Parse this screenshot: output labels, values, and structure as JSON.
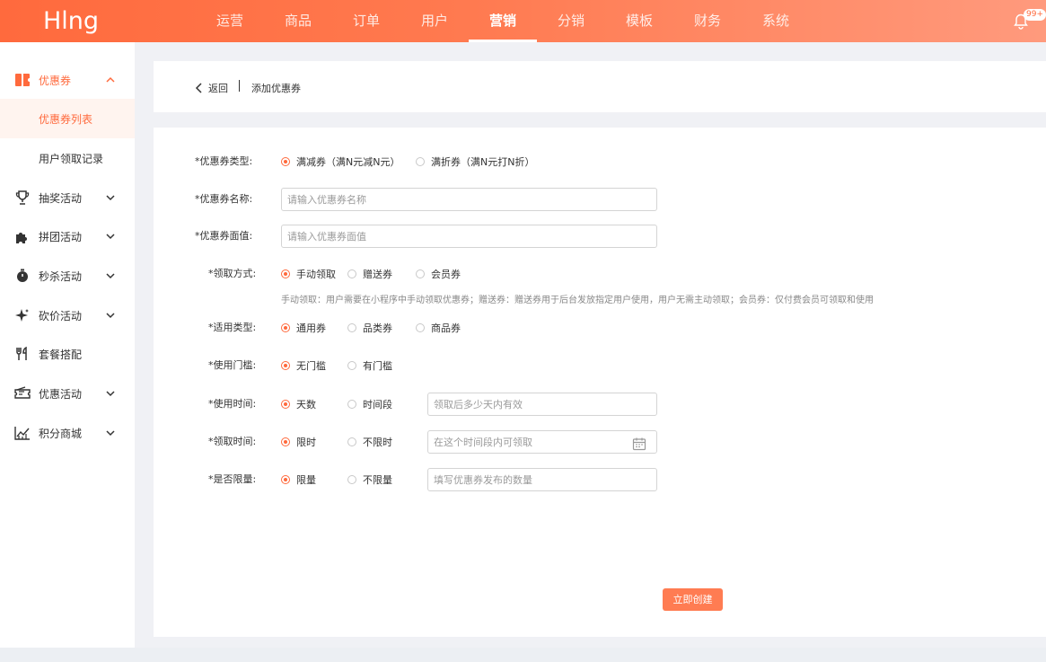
{
  "app": {
    "logo": "Hlng",
    "notification_count": "99+"
  },
  "nav": [
    {
      "label": "运营",
      "active": false
    },
    {
      "label": "商品",
      "active": false
    },
    {
      "label": "订单",
      "active": false
    },
    {
      "label": "用户",
      "active": false
    },
    {
      "label": "营销",
      "active": true
    },
    {
      "label": "分销",
      "active": false
    },
    {
      "label": "模板",
      "active": false
    },
    {
      "label": "财务",
      "active": false
    },
    {
      "label": "系统",
      "active": false
    }
  ],
  "sidebar": {
    "items": [
      {
        "label": "优惠券",
        "icon": "coupon-icon"
      },
      {
        "label": "抽奖活动",
        "icon": "trophy-icon"
      },
      {
        "label": "拼团活动",
        "icon": "puzzle-icon"
      },
      {
        "label": "秒杀活动",
        "icon": "stopwatch-icon"
      },
      {
        "label": "砍价活动",
        "icon": "sparkle-icon"
      },
      {
        "label": "套餐搭配",
        "icon": "utensils-icon"
      },
      {
        "label": "优惠活动",
        "icon": "ticket-icon"
      },
      {
        "label": "积分商城",
        "icon": "chart-icon"
      }
    ],
    "subitems": [
      {
        "label": "优惠券列表",
        "active": true
      },
      {
        "label": "用户领取记录",
        "active": false
      }
    ]
  },
  "breadcrumb": {
    "back": "返回",
    "current": "添加优惠券"
  },
  "form": {
    "type": {
      "label": "*优惠券类型:",
      "options": [
        "满减券（满N元减N元）",
        "满折券（满N元打N折）"
      ]
    },
    "name": {
      "label": "*优惠券名称:",
      "placeholder": "请输入优惠券名称"
    },
    "value": {
      "label": "*优惠券面值:",
      "placeholder": "请输入优惠券面值"
    },
    "method": {
      "label": "*领取方式:",
      "options": [
        "手动领取",
        "赠送券",
        "会员券"
      ],
      "hint": "手动领取：用户需要在小程序中手动领取优惠券；赠送券：赠送券用于后台发放指定用户使用，用户无需主动领取；会员券：仅付费会员可领取和使用"
    },
    "scope": {
      "label": "*适用类型:",
      "options": [
        "通用券",
        "品类券",
        "商品券"
      ]
    },
    "threshold": {
      "label": "*使用门槛:",
      "options": [
        "无门槛",
        "有门槛"
      ]
    },
    "use_time": {
      "label": "*使用时间:",
      "options": [
        "天数",
        "时间段"
      ],
      "placeholder": "领取后多少天内有效"
    },
    "claim_time": {
      "label": "*领取时间:",
      "options": [
        "限时",
        "不限时"
      ],
      "placeholder": "在这个时间段内可领取"
    },
    "limit": {
      "label": "*是否限量:",
      "options": [
        "限量",
        "不限量"
      ],
      "placeholder": "填写优惠券发布的数量"
    },
    "submit": "立即创建"
  }
}
